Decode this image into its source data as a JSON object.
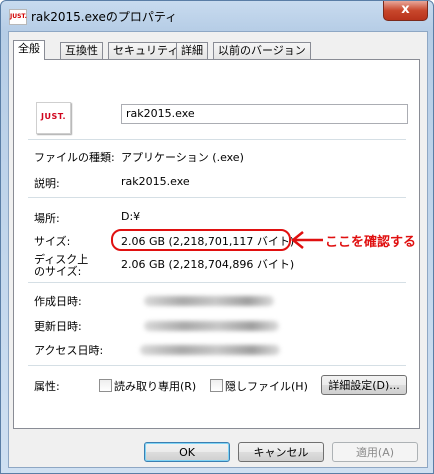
{
  "window": {
    "title": "rak2015.exeのプロパティ",
    "app_icon_text": "JUST.",
    "close_label": "x"
  },
  "tabs": [
    {
      "label": "全般"
    },
    {
      "label": "互換性"
    },
    {
      "label": "セキュリティ"
    },
    {
      "label": "詳細"
    },
    {
      "label": "以前のバージョン"
    }
  ],
  "general": {
    "file_icon_text": "JUST.",
    "file_name": "rak2015.exe",
    "file_type_label": "ファイルの種類:",
    "file_type_value": "アプリケーション (.exe)",
    "description_label": "説明:",
    "description_value": "rak2015.exe",
    "location_label": "場所:",
    "location_value": "D:¥",
    "size_label": "サイズ:",
    "size_value": "2.06 GB (2,218,701,117 バイト)",
    "disk_size_label_1": "ディスク上",
    "disk_size_label_2": "のサイズ:",
    "disk_size_value": "2.06 GB (2,218,704,896 バイト)",
    "created_label": "作成日時:",
    "modified_label": "更新日時:",
    "accessed_label": "アクセス日時:",
    "attributes_label": "属性:",
    "readonly_label": "読み取り専用(R)",
    "hidden_label": "隠しファイル(H)",
    "advanced_button": "詳細設定(D)..."
  },
  "annotation": {
    "text": "ここを確認する",
    "color": "#e01010"
  },
  "footer": {
    "ok": "OK",
    "cancel": "キャンセル",
    "apply": "適用(A)"
  }
}
